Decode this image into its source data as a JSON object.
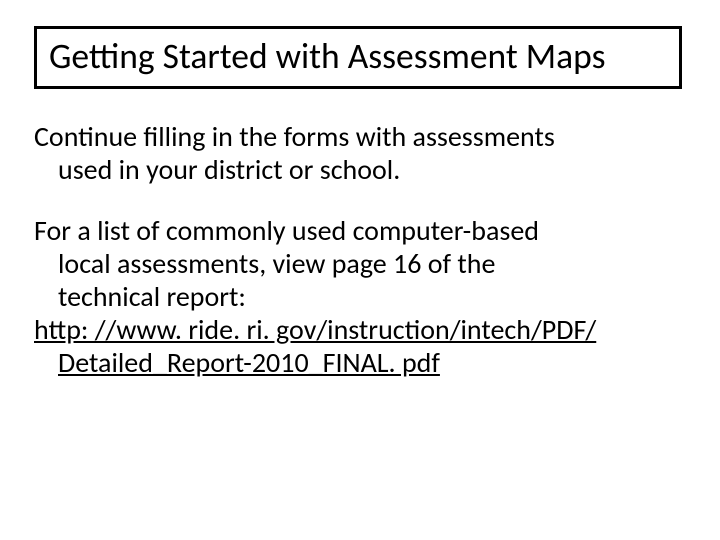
{
  "slide": {
    "title": "Getting Started with Assessment Maps",
    "paragraph1_line1": "Continue filling in the forms with assessments",
    "paragraph1_line2": "used in your district or school.",
    "paragraph2_line1": "For a list of commonly used computer-based",
    "paragraph2_line2": "local assessments, view page 16 of the",
    "paragraph2_line3": "technical report:",
    "link_line1": "http: //www. ride. ri. gov/instruction/intech/PDF/",
    "link_line2": "Detailed_Report-2010_FINAL. pdf"
  }
}
